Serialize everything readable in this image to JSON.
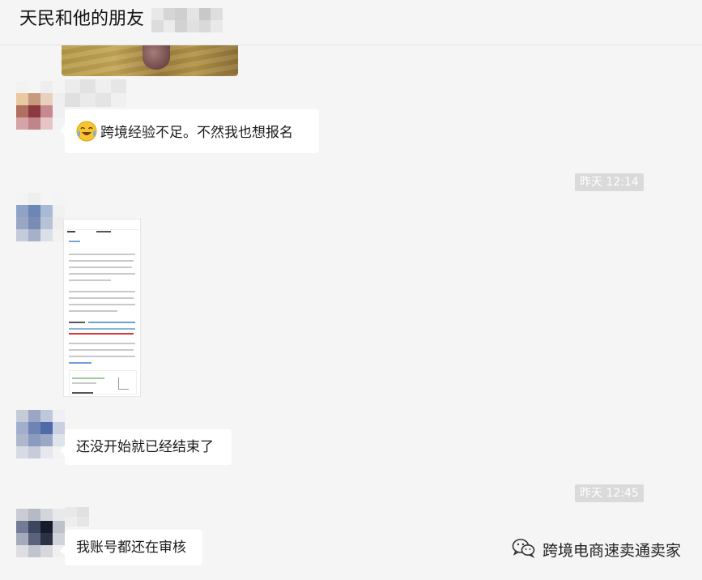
{
  "header": {
    "title": "天民和他的朋友"
  },
  "messages": [
    {
      "type": "image-tail"
    },
    {
      "type": "text",
      "text": "跨境经验不足。不然我也想报名",
      "emoji": "crying-laughing-face-icon"
    },
    {
      "type": "time",
      "text": "昨天 12:14"
    },
    {
      "type": "image",
      "description": "screenshot"
    },
    {
      "type": "text",
      "text": "还没开始就已经结束了"
    },
    {
      "type": "time",
      "text": "昨天 12:45"
    },
    {
      "type": "text",
      "text": "我账号都还在审核"
    }
  ],
  "watermark": {
    "label": "跨境电商速卖通卖家",
    "icon": "wechat-icon"
  },
  "colors": {
    "background": "#f5f5f5",
    "bubble": "#ffffff",
    "time_badge": "#dadada"
  }
}
